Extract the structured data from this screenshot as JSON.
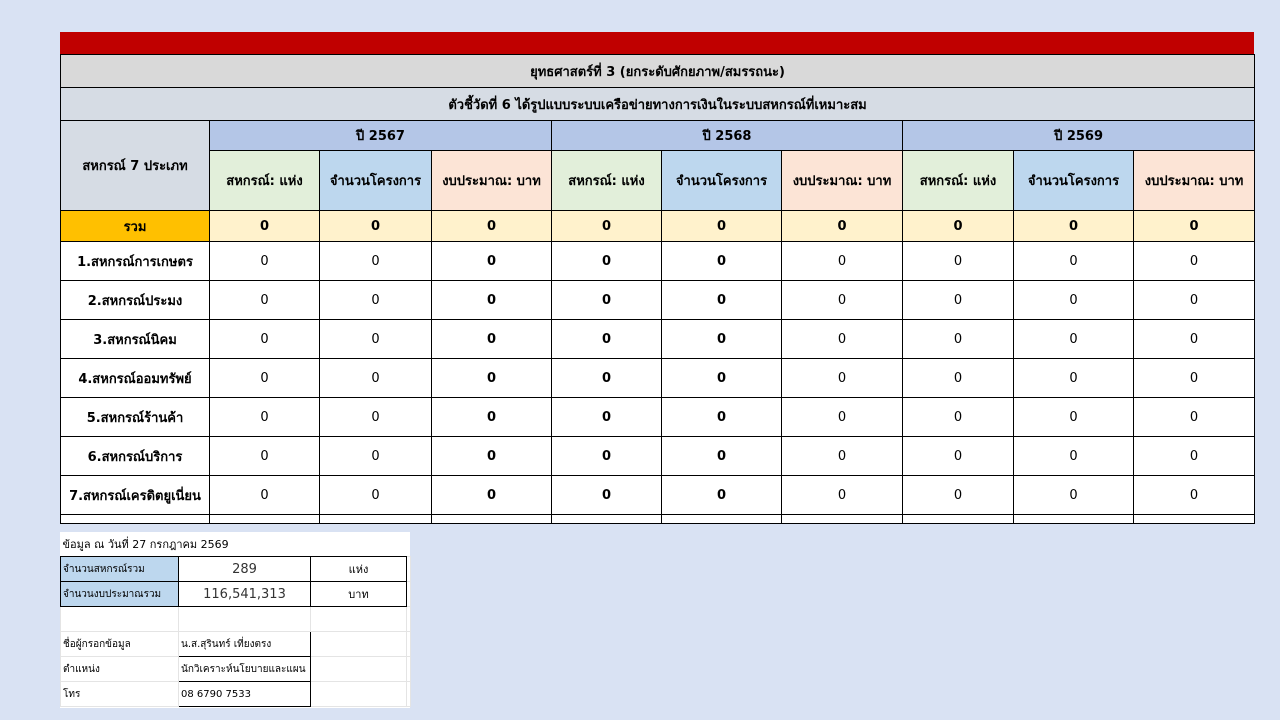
{
  "title": "ยุทธศาสตร์ที่ 3 (ยกระดับศักยภาพ/สมรรถนะ)",
  "subtitle": "ตัวชี้วัดที่ 6 ได้รูปแบบระบบเครือข่ายทางการเงินในระบบสหกรณ์ที่เหมาะสม",
  "type_header": "สหกรณ์ 7 ประเภท",
  "years": [
    "ปี 2567",
    "ปี 2568",
    "ปี 2569"
  ],
  "sub_headers": [
    "สหกรณ์: แห่ง",
    "จำนวนโครงการ",
    "งบประมาณ: บาท"
  ],
  "total": {
    "label": "รวม",
    "values": [
      "0",
      "0",
      "0",
      "0",
      "0",
      "0",
      "0",
      "0",
      "0"
    ]
  },
  "rows": [
    {
      "name": "1.สหกรณ์การเกษตร",
      "values": [
        "0",
        "0",
        "0",
        "0",
        "0",
        "0",
        "0",
        "0",
        "0"
      ]
    },
    {
      "name": "2.สหกรณ์ประมง",
      "values": [
        "0",
        "0",
        "0",
        "0",
        "0",
        "0",
        "0",
        "0",
        "0"
      ]
    },
    {
      "name": "3.สหกรณ์นิคม",
      "values": [
        "0",
        "0",
        "0",
        "0",
        "0",
        "0",
        "0",
        "0",
        "0"
      ]
    },
    {
      "name": "4.สหกรณ์ออมทรัพย์",
      "values": [
        "0",
        "0",
        "0",
        "0",
        "0",
        "0",
        "0",
        "0",
        "0"
      ]
    },
    {
      "name": "5.สหกรณ์ร้านค้า",
      "values": [
        "0",
        "0",
        "0",
        "0",
        "0",
        "0",
        "0",
        "0",
        "0"
      ]
    },
    {
      "name": "6.สหกรณ์บริการ",
      "values": [
        "0",
        "0",
        "0",
        "0",
        "0",
        "0",
        "0",
        "0",
        "0"
      ]
    },
    {
      "name": "7.สหกรณ์เครดิตยูเนี่ยน",
      "values": [
        "0",
        "0",
        "0",
        "0",
        "0",
        "0",
        "0",
        "0",
        "0"
      ]
    }
  ],
  "info": {
    "date_line": "ข้อมูล ณ วันที่  27 กรกฎาคม 2569",
    "total_coops_label": "จำนวนสหกรณ์รวม",
    "total_coops_value": "289",
    "total_coops_unit": "แห่ง",
    "total_budget_label": "จำนวนงบประมาณรวม",
    "total_budget_value": "116,541,313",
    "total_budget_unit": "บาท",
    "recorder_label": "ชื่อผู้กรอกข้อมูล",
    "recorder_value": "น.ส.สุรินทร์ เที่ยงตรง",
    "position_label": "ตำแหน่ง",
    "position_value": "นักวิเคราะห์นโยบายและแผน",
    "phone_label": "โทร",
    "phone_value": "08 6790 7533"
  },
  "colors": {
    "background": "#d9e2f3",
    "top_bar": "#c00000",
    "total_label": "#ffc000",
    "total_values": "#fff2cc",
    "year_header": "#b4c6e7",
    "sub_coop": "#e2efda",
    "sub_project": "#bdd7ee",
    "sub_budget": "#fce4d6"
  }
}
